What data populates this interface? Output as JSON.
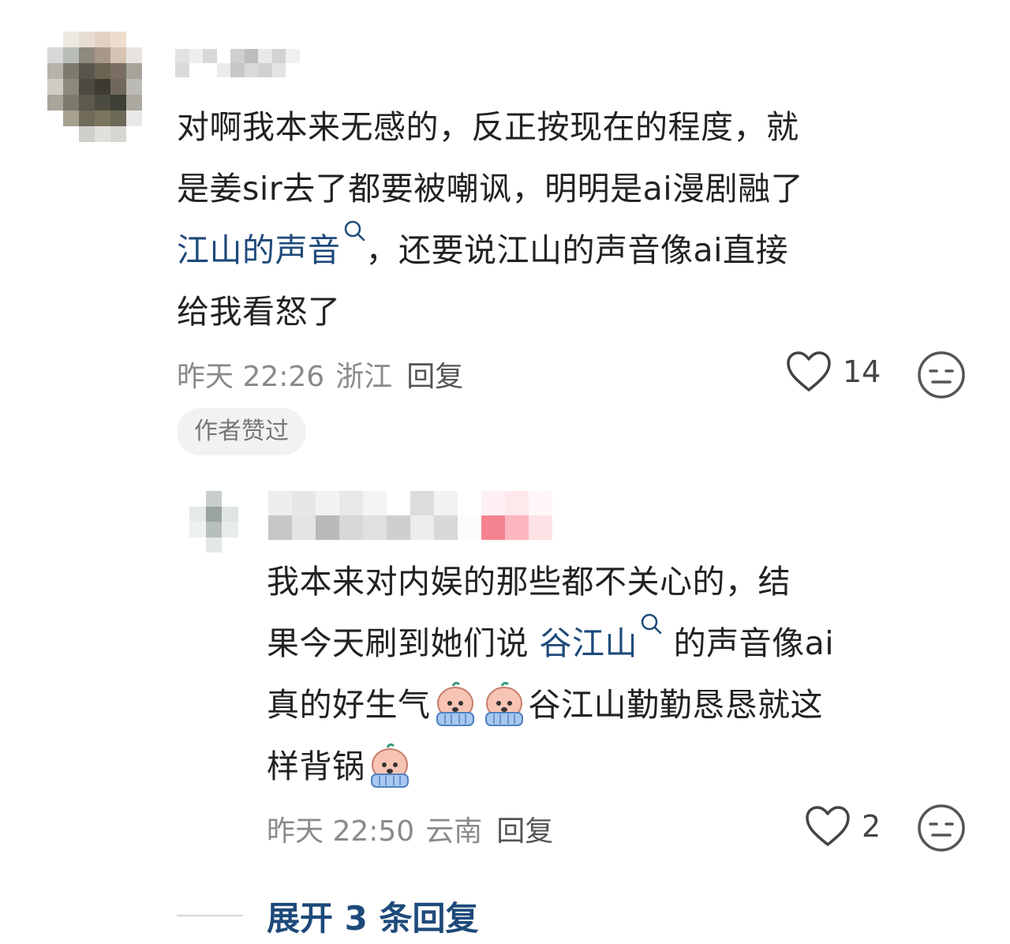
{
  "comment1": {
    "text_line1": "对啊我本来无感的，反正按现在的程度，就",
    "text_line2": "是姜sir去了都要被嘲讽，明明是ai漫剧融了",
    "topic_link": "江山的声音",
    "text_line3_rest": "，还要说江山的声音像ai直接",
    "text_line4": "给我看怒了",
    "time": "昨天 22:26",
    "location": "浙江",
    "reply_label": "回复",
    "like_count": "14",
    "badge": "作者赞过"
  },
  "comment2": {
    "text_line1": "我本来对内娱的那些都不关心的，结",
    "text_line2_pre": "果今天刷到她们说 ",
    "topic_link": "谷江山",
    "text_line2_post": " 的声音像ai",
    "text_line3_pre": "真的好生气",
    "text_line3_post": "谷江山勤勤恳恳就这",
    "text_line4_pre": "样背锅",
    "time": "昨天 22:50",
    "location": "云南",
    "reply_label": "回复",
    "like_count": "2"
  },
  "expand_replies": "展开 3 条回复",
  "icons": {
    "like": "heart-outline-icon",
    "emoji": "neutral-face-icon",
    "search": "search-icon",
    "sticker": "crying-sticker-icon"
  },
  "colors": {
    "link": "#1e4a7a",
    "meta": "#8a8a8a",
    "badge_bg": "#f2f2f2"
  }
}
